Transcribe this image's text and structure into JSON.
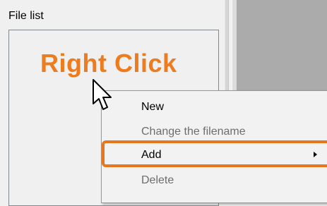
{
  "file_list": {
    "label": "File list"
  },
  "annotation": {
    "text": "Right Click",
    "color": "#ec7c1f"
  },
  "context_menu": {
    "items": [
      {
        "label": "New",
        "enabled": true
      },
      {
        "label": "Change the filename",
        "enabled": false
      },
      {
        "label": "Add",
        "enabled": true,
        "has_submenu": true,
        "highlighted": true
      },
      {
        "label": "Delete",
        "enabled": false
      }
    ]
  },
  "icons": {
    "cursor": "mouse-pointer-icon",
    "submenu": "chevron-right-icon"
  },
  "colors": {
    "highlight": "#e8761c",
    "disabled_text": "#6d6d6d"
  }
}
